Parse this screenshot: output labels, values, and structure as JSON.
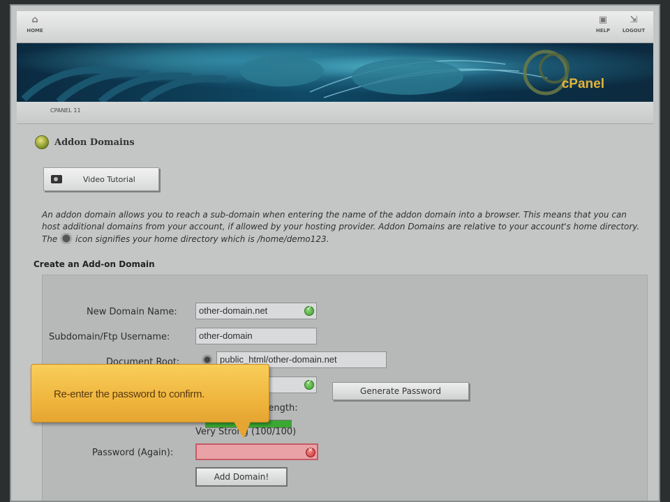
{
  "toolbar": {
    "home_label": "HOME",
    "help_label": "HELP",
    "logout_label": "LOGOUT"
  },
  "banner": {
    "logo_text": "cPanel"
  },
  "breadcrumb": {
    "text": "CPANEL 11"
  },
  "page": {
    "title": "Addon Domains",
    "video_button_label": "Video Tutorial",
    "intro_part1": "An addon domain allows you to reach a sub-domain when entering the name of the addon domain into a browser. This means that you can host additional domains from your account, if allowed by your hosting provider. Addon Domains are relative to your account's home directory. The",
    "intro_part2": "icon signifies your home directory which is /home/demo123.",
    "section_title": "Create an Add-on Domain"
  },
  "form": {
    "new_domain_label": "New Domain Name:",
    "new_domain_value": "other-domain.net",
    "subdomain_label": "Subdomain/Ftp Username:",
    "subdomain_value": "other-domain",
    "docroot_label": "Document Root:",
    "docroot_value": "public_html/other-domain.net",
    "password_value": "••••••••••••••",
    "generate_button_label": "Generate Password",
    "strength_label": "Strength:",
    "strength_text": "Very Strong (100/100)",
    "strength_percent": 100,
    "password_again_label": "Password (Again):",
    "password_again_value": "",
    "add_button_label": "Add Domain!"
  },
  "tooltip": {
    "text": "Re-enter the password to confirm."
  },
  "colors": {
    "tooltip_bg": "#eeb23a",
    "error_field_bg": "#e9a3a6",
    "strength_fill": "#3aa832"
  }
}
